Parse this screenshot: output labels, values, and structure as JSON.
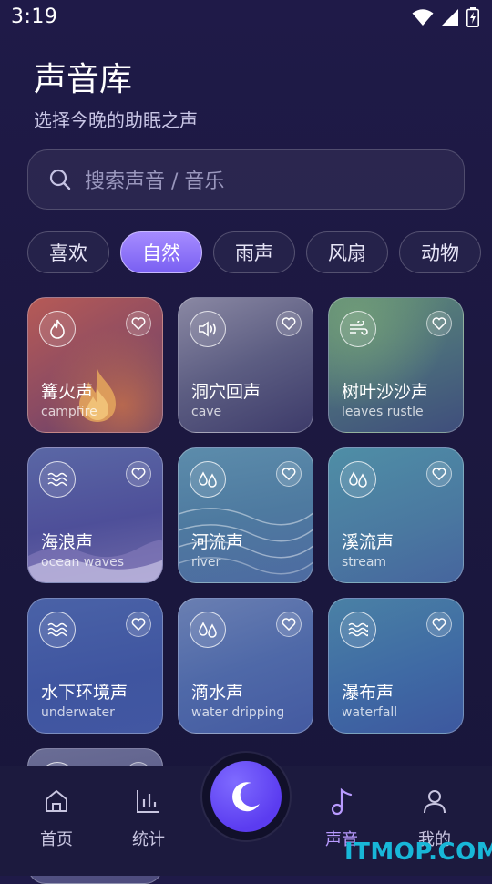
{
  "status_bar": {
    "time": "3:19"
  },
  "header": {
    "title": "声音库",
    "subtitle": "选择今晚的助眠之声"
  },
  "search": {
    "placeholder": "搜索声音 / 音乐"
  },
  "categories": [
    {
      "label": "喜欢",
      "active": false
    },
    {
      "label": "自然",
      "active": true
    },
    {
      "label": "雨声",
      "active": false
    },
    {
      "label": "风扇",
      "active": false
    },
    {
      "label": "动物",
      "active": false
    }
  ],
  "sounds": [
    {
      "name": "篝火声",
      "en": "campfire",
      "icon": "flame-icon"
    },
    {
      "name": "洞穴回声",
      "en": "cave",
      "icon": "speaker-icon"
    },
    {
      "name": "树叶沙沙声",
      "en": "leaves rustle",
      "icon": "wind-icon"
    },
    {
      "name": "海浪声",
      "en": "ocean waves",
      "icon": "waves-icon"
    },
    {
      "name": "河流声",
      "en": "river",
      "icon": "drops-icon"
    },
    {
      "name": "溪流声",
      "en": "stream",
      "icon": "drops-icon"
    },
    {
      "name": "水下环境声",
      "en": "underwater",
      "icon": "waves-icon"
    },
    {
      "name": "滴水声",
      "en": "water dripping",
      "icon": "drops-icon"
    },
    {
      "name": "瀑布声",
      "en": "waterfall",
      "icon": "waves-icon"
    }
  ],
  "nav": {
    "items": [
      {
        "label": "首页",
        "icon": "home-icon",
        "active": false
      },
      {
        "label": "统计",
        "icon": "chart-icon",
        "active": false
      },
      {
        "label": "声音",
        "icon": "music-note-icon",
        "active": true
      },
      {
        "label": "我的",
        "icon": "user-icon",
        "active": false
      }
    ],
    "center_icon": "moon-icon"
  },
  "watermark": "ITMOP.COM",
  "colors": {
    "accent": "#8b6cff",
    "active_nav": "#b99bff",
    "watermark": "#18b7d8"
  }
}
